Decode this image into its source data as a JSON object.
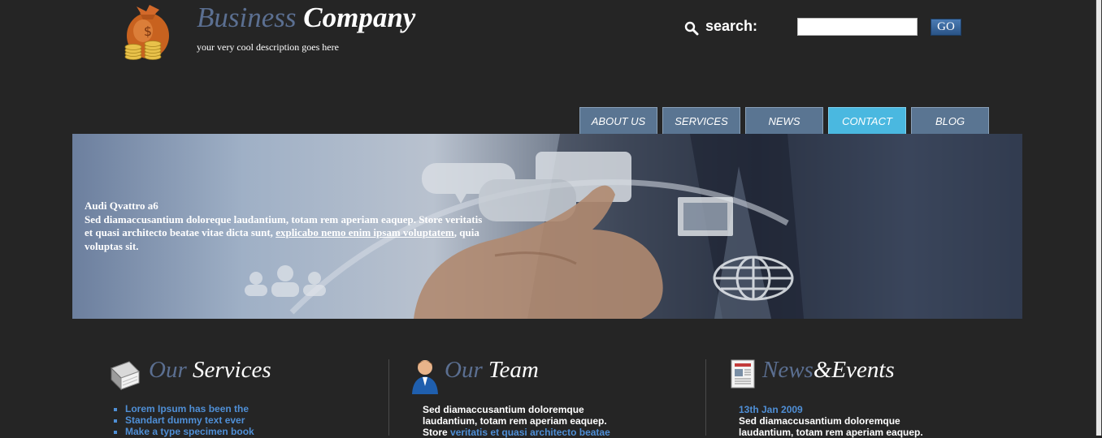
{
  "brand": {
    "title_part1": "Business",
    "title_part2": "Company",
    "description": "your very cool description goes here",
    "logo_icon": "money-bag-icon"
  },
  "search": {
    "label": "search:",
    "value": "",
    "button_label": "GO",
    "icon": "search-icon"
  },
  "nav": {
    "items": [
      {
        "label": "ABOUT US"
      },
      {
        "label": "SERVICES"
      },
      {
        "label": "NEWS"
      },
      {
        "label": "CONTACT",
        "active": true
      },
      {
        "label": "BLOG"
      }
    ]
  },
  "banner": {
    "title": "Audi Qvattro a6",
    "text_before_link": "Sed diamaccusantium doloreque laudantium, totam rem aperiam eaquep. Store veritatis et quasi architecto beatae vitae dicta sunt, ",
    "link_text": "explicabo nemo enim ipsam voluptatem",
    "text_after_link": ", quia voluptas sit."
  },
  "services": {
    "heading_part1": "Our",
    "heading_part2": "Services",
    "icon": "book-icon",
    "items": [
      "Lorem Ipsum has been the",
      "Standart dummy text ever",
      "Make a type specimen book"
    ]
  },
  "team": {
    "heading_part1": "Our",
    "heading_part2": "Team",
    "icon": "person-icon",
    "text_line1": "Sed diamaccusantium doloremque",
    "text_line2": "laudantium, totam rem aperiam eaquep.",
    "text_line3_start": "Store",
    "text_line3_link": "veritatis et quasi architecto beatae"
  },
  "news": {
    "heading_part1": "News",
    "heading_part2": "&Events",
    "icon": "newspaper-icon",
    "date": "13th Jan 2009",
    "text_line1": "Sed diamaccusantium doloremque",
    "text_line2": "laudantium, totam rem aperiam eaquep."
  },
  "colors": {
    "background": "#252525",
    "accent_blue": "#4f8fd6",
    "heading_muted": "#5b6f91",
    "nav_active": "#4ab8e0",
    "nav_default": "#5a7592"
  }
}
